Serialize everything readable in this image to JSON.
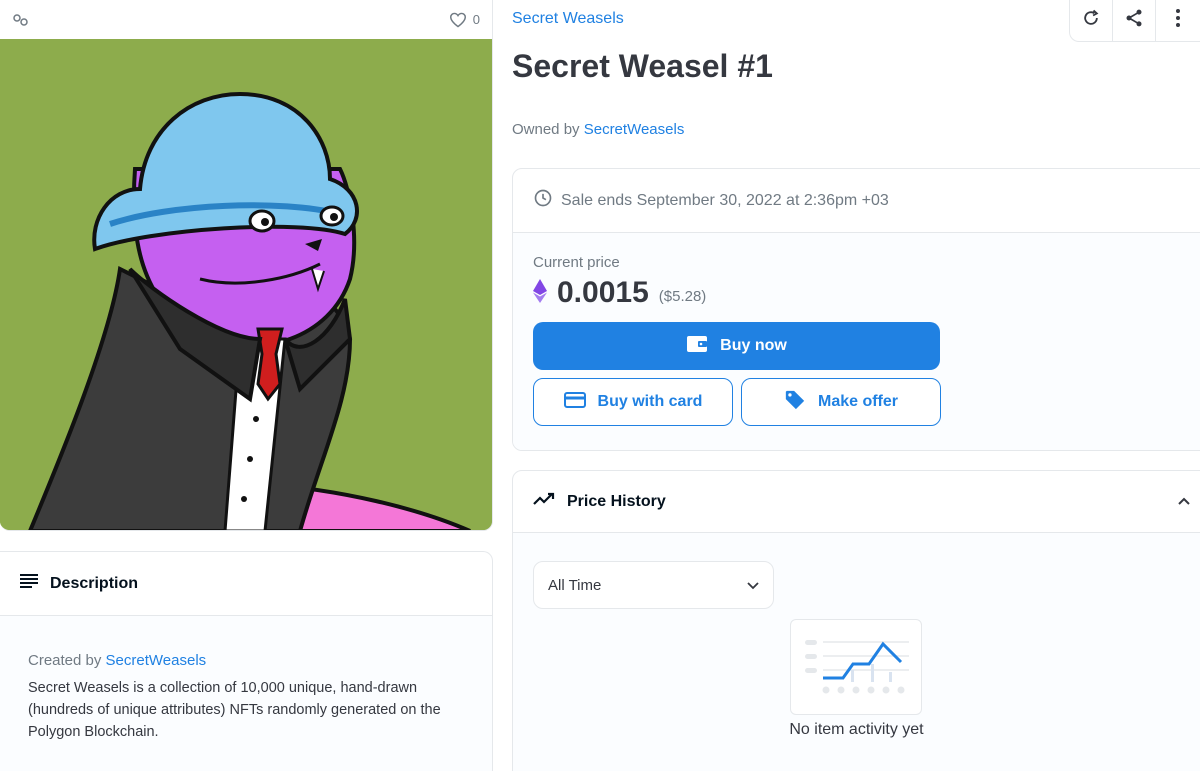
{
  "asset": {
    "favorites_count": "0"
  },
  "description": {
    "heading": "Description",
    "created_by_label": "Created by",
    "creator": "SecretWeasels",
    "text": "Secret Weasels is a collection of 10,000 unique, hand-drawn (hundreds of unique attributes) NFTs randomly generated on the Polygon Blockchain."
  },
  "header": {
    "collection": "Secret Weasels",
    "title": "Secret Weasel #1",
    "owned_by_label": "Owned by",
    "owner": "SecretWeasels"
  },
  "toolbar": {
    "refresh_icon": "refresh-icon",
    "share_icon": "share-icon",
    "more_icon": "more-vertical-icon"
  },
  "trade": {
    "sale_ends": "Sale ends September 30, 2022 at 2:36pm +03",
    "current_price_label": "Current price",
    "price": "0.0015",
    "usd": "($5.28)",
    "buy_now": "Buy now",
    "buy_with_card": "Buy with card",
    "make_offer": "Make offer"
  },
  "price_history": {
    "heading": "Price History",
    "filter_selected": "All Time",
    "empty_text": "No item activity yet"
  },
  "colors": {
    "accent": "#2081e2",
    "art_background": "#8dac4c",
    "eth": "#8247e5"
  }
}
